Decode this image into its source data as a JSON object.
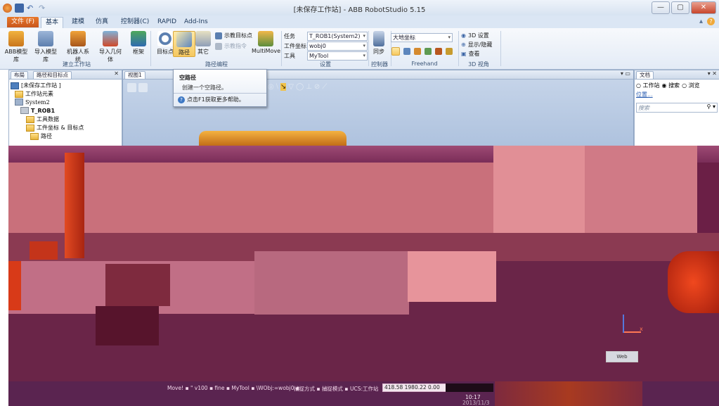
{
  "window": {
    "title": "[未保存工作站] - ABB RobotStudio 5.15",
    "controls": [
      "—",
      "▢",
      "✕"
    ]
  },
  "ribbon_tabs": [
    "文件 (F)",
    "基本",
    "建模",
    "仿真",
    "控制器(C)",
    "RAPID",
    "Add-Ins"
  ],
  "ribbon": {
    "build_station": {
      "buttons": [
        "ABB模型库",
        "导入模型库",
        "机器人系统",
        "导入几何体",
        "框架"
      ],
      "label": "建立工作站"
    },
    "path_programming": {
      "buttons": [
        "目标点",
        "路径",
        "其它"
      ],
      "small": [
        "示教目标点",
        "示教指令"
      ],
      "multimove": "MultiMove",
      "label": "路径编程"
    },
    "settings": {
      "task_label": "任务",
      "task_value": "T_ROB1(System2)",
      "wobj_label": "工件坐标",
      "wobj_value": "wobj0",
      "tool_label": "工具",
      "tool_value": "MyTool",
      "label": "设置"
    },
    "controller": {
      "sync": "同步",
      "label": "控制器"
    },
    "freehand": {
      "frame": "大地坐标",
      "label": "Freehand"
    },
    "view3d": {
      "items": [
        "3D 设置",
        "显示/隐藏",
        "查看"
      ],
      "label": "3D 视角"
    }
  },
  "left_panel": {
    "tabs": [
      "布局",
      "路径和目标点"
    ],
    "tree": [
      "[未保存工作站 ]",
      "工作站元素",
      "System2",
      "T_ROB1",
      "工具数据",
      "工件坐标 & 目标点",
      "路径"
    ]
  },
  "view_tab": "视图1",
  "tooltip": {
    "title": "空路径",
    "desc": "创建一个空路径。",
    "help": "点击F1获取更多帮助。"
  },
  "right_panel": {
    "tab": "文档",
    "radios": [
      "工作站",
      "搜索",
      "浏览"
    ],
    "link": "位置...",
    "search_placeholder": "搜索"
  },
  "scene": {
    "tab": "Web",
    "axis_label": "x"
  },
  "status": {
    "text": "Move! ▪ \" v100 ▪ fine ▪ MyTool ▪ \\WObj:=wobj0 ▪",
    "mode": "捕捉方式 ▪ 捕捉模式 ▪",
    "ucs": "UCS:工作站",
    "coords": "418.58  1980.22  0.00",
    "time": "10:17",
    "date": "2013/11/3"
  },
  "colors": {
    "file_tab": "#d2632a",
    "scene_bg": "#6b1f46",
    "robot": "#d83a18"
  }
}
